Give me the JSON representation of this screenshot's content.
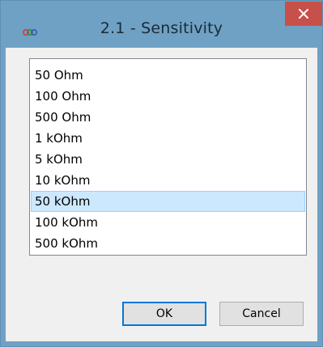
{
  "window": {
    "title": "2.1 - Sensitivity",
    "app_icon": "dots-logo-icon",
    "close_icon": "close-icon"
  },
  "list": {
    "items": [
      {
        "label": "50 Ohm"
      },
      {
        "label": "100 Ohm"
      },
      {
        "label": "500 Ohm"
      },
      {
        "label": "1 kOhm"
      },
      {
        "label": "5 kOhm"
      },
      {
        "label": "10 kOhm"
      },
      {
        "label": "50 kOhm"
      },
      {
        "label": "100 kOhm"
      },
      {
        "label": "500 kOhm"
      }
    ],
    "selected_label": "50 kOhm"
  },
  "buttons": {
    "ok_label": "OK",
    "cancel_label": "Cancel"
  },
  "colors": {
    "titlebar": "#6fa1c4",
    "close_button": "#c7504a",
    "selection_fill": "#cce8ff",
    "selection_border": "#99d1ff"
  }
}
